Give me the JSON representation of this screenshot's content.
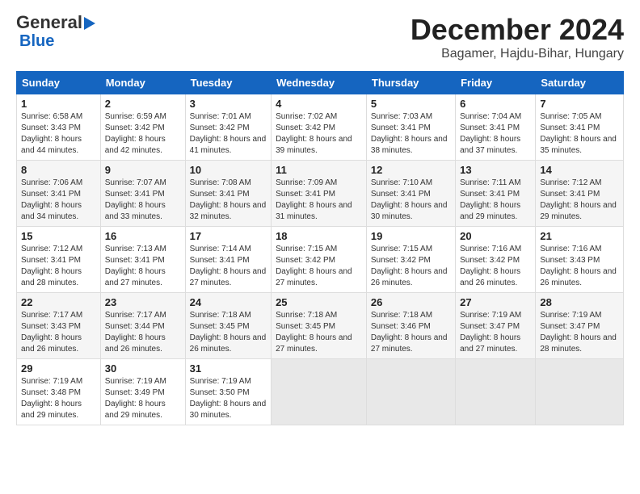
{
  "header": {
    "logo_line1": "General",
    "logo_line2": "Blue",
    "title": "December 2024",
    "subtitle": "Bagamer, Hajdu-Bihar, Hungary"
  },
  "calendar": {
    "weekdays": [
      "Sunday",
      "Monday",
      "Tuesday",
      "Wednesday",
      "Thursday",
      "Friday",
      "Saturday"
    ],
    "weeks": [
      [
        null,
        null,
        {
          "day": 1,
          "sunrise": "Sunrise: 6:58 AM",
          "sunset": "Sunset: 3:43 PM",
          "daylight": "Daylight: 8 hours and 44 minutes."
        },
        {
          "day": 2,
          "sunrise": "Sunrise: 6:59 AM",
          "sunset": "Sunset: 3:42 PM",
          "daylight": "Daylight: 8 hours and 42 minutes."
        },
        {
          "day": 3,
          "sunrise": "Sunrise: 7:01 AM",
          "sunset": "Sunset: 3:42 PM",
          "daylight": "Daylight: 8 hours and 41 minutes."
        },
        {
          "day": 4,
          "sunrise": "Sunrise: 7:02 AM",
          "sunset": "Sunset: 3:42 PM",
          "daylight": "Daylight: 8 hours and 39 minutes."
        },
        {
          "day": 5,
          "sunrise": "Sunrise: 7:03 AM",
          "sunset": "Sunset: 3:41 PM",
          "daylight": "Daylight: 8 hours and 38 minutes."
        },
        {
          "day": 6,
          "sunrise": "Sunrise: 7:04 AM",
          "sunset": "Sunset: 3:41 PM",
          "daylight": "Daylight: 8 hours and 37 minutes."
        },
        {
          "day": 7,
          "sunrise": "Sunrise: 7:05 AM",
          "sunset": "Sunset: 3:41 PM",
          "daylight": "Daylight: 8 hours and 35 minutes."
        }
      ],
      [
        {
          "day": 8,
          "sunrise": "Sunrise: 7:06 AM",
          "sunset": "Sunset: 3:41 PM",
          "daylight": "Daylight: 8 hours and 34 minutes."
        },
        {
          "day": 9,
          "sunrise": "Sunrise: 7:07 AM",
          "sunset": "Sunset: 3:41 PM",
          "daylight": "Daylight: 8 hours and 33 minutes."
        },
        {
          "day": 10,
          "sunrise": "Sunrise: 7:08 AM",
          "sunset": "Sunset: 3:41 PM",
          "daylight": "Daylight: 8 hours and 32 minutes."
        },
        {
          "day": 11,
          "sunrise": "Sunrise: 7:09 AM",
          "sunset": "Sunset: 3:41 PM",
          "daylight": "Daylight: 8 hours and 31 minutes."
        },
        {
          "day": 12,
          "sunrise": "Sunrise: 7:10 AM",
          "sunset": "Sunset: 3:41 PM",
          "daylight": "Daylight: 8 hours and 30 minutes."
        },
        {
          "day": 13,
          "sunrise": "Sunrise: 7:11 AM",
          "sunset": "Sunset: 3:41 PM",
          "daylight": "Daylight: 8 hours and 29 minutes."
        },
        {
          "day": 14,
          "sunrise": "Sunrise: 7:12 AM",
          "sunset": "Sunset: 3:41 PM",
          "daylight": "Daylight: 8 hours and 29 minutes."
        }
      ],
      [
        {
          "day": 15,
          "sunrise": "Sunrise: 7:12 AM",
          "sunset": "Sunset: 3:41 PM",
          "daylight": "Daylight: 8 hours and 28 minutes."
        },
        {
          "day": 16,
          "sunrise": "Sunrise: 7:13 AM",
          "sunset": "Sunset: 3:41 PM",
          "daylight": "Daylight: 8 hours and 27 minutes."
        },
        {
          "day": 17,
          "sunrise": "Sunrise: 7:14 AM",
          "sunset": "Sunset: 3:41 PM",
          "daylight": "Daylight: 8 hours and 27 minutes."
        },
        {
          "day": 18,
          "sunrise": "Sunrise: 7:15 AM",
          "sunset": "Sunset: 3:42 PM",
          "daylight": "Daylight: 8 hours and 27 minutes."
        },
        {
          "day": 19,
          "sunrise": "Sunrise: 7:15 AM",
          "sunset": "Sunset: 3:42 PM",
          "daylight": "Daylight: 8 hours and 26 minutes."
        },
        {
          "day": 20,
          "sunrise": "Sunrise: 7:16 AM",
          "sunset": "Sunset: 3:42 PM",
          "daylight": "Daylight: 8 hours and 26 minutes."
        },
        {
          "day": 21,
          "sunrise": "Sunrise: 7:16 AM",
          "sunset": "Sunset: 3:43 PM",
          "daylight": "Daylight: 8 hours and 26 minutes."
        }
      ],
      [
        {
          "day": 22,
          "sunrise": "Sunrise: 7:17 AM",
          "sunset": "Sunset: 3:43 PM",
          "daylight": "Daylight: 8 hours and 26 minutes."
        },
        {
          "day": 23,
          "sunrise": "Sunrise: 7:17 AM",
          "sunset": "Sunset: 3:44 PM",
          "daylight": "Daylight: 8 hours and 26 minutes."
        },
        {
          "day": 24,
          "sunrise": "Sunrise: 7:18 AM",
          "sunset": "Sunset: 3:45 PM",
          "daylight": "Daylight: 8 hours and 26 minutes."
        },
        {
          "day": 25,
          "sunrise": "Sunrise: 7:18 AM",
          "sunset": "Sunset: 3:45 PM",
          "daylight": "Daylight: 8 hours and 27 minutes."
        },
        {
          "day": 26,
          "sunrise": "Sunrise: 7:18 AM",
          "sunset": "Sunset: 3:46 PM",
          "daylight": "Daylight: 8 hours and 27 minutes."
        },
        {
          "day": 27,
          "sunrise": "Sunrise: 7:19 AM",
          "sunset": "Sunset: 3:47 PM",
          "daylight": "Daylight: 8 hours and 27 minutes."
        },
        {
          "day": 28,
          "sunrise": "Sunrise: 7:19 AM",
          "sunset": "Sunset: 3:47 PM",
          "daylight": "Daylight: 8 hours and 28 minutes."
        }
      ],
      [
        {
          "day": 29,
          "sunrise": "Sunrise: 7:19 AM",
          "sunset": "Sunset: 3:48 PM",
          "daylight": "Daylight: 8 hours and 29 minutes."
        },
        {
          "day": 30,
          "sunrise": "Sunrise: 7:19 AM",
          "sunset": "Sunset: 3:49 PM",
          "daylight": "Daylight: 8 hours and 29 minutes."
        },
        {
          "day": 31,
          "sunrise": "Sunrise: 7:19 AM",
          "sunset": "Sunset: 3:50 PM",
          "daylight": "Daylight: 8 hours and 30 minutes."
        },
        null,
        null,
        null,
        null
      ]
    ]
  }
}
